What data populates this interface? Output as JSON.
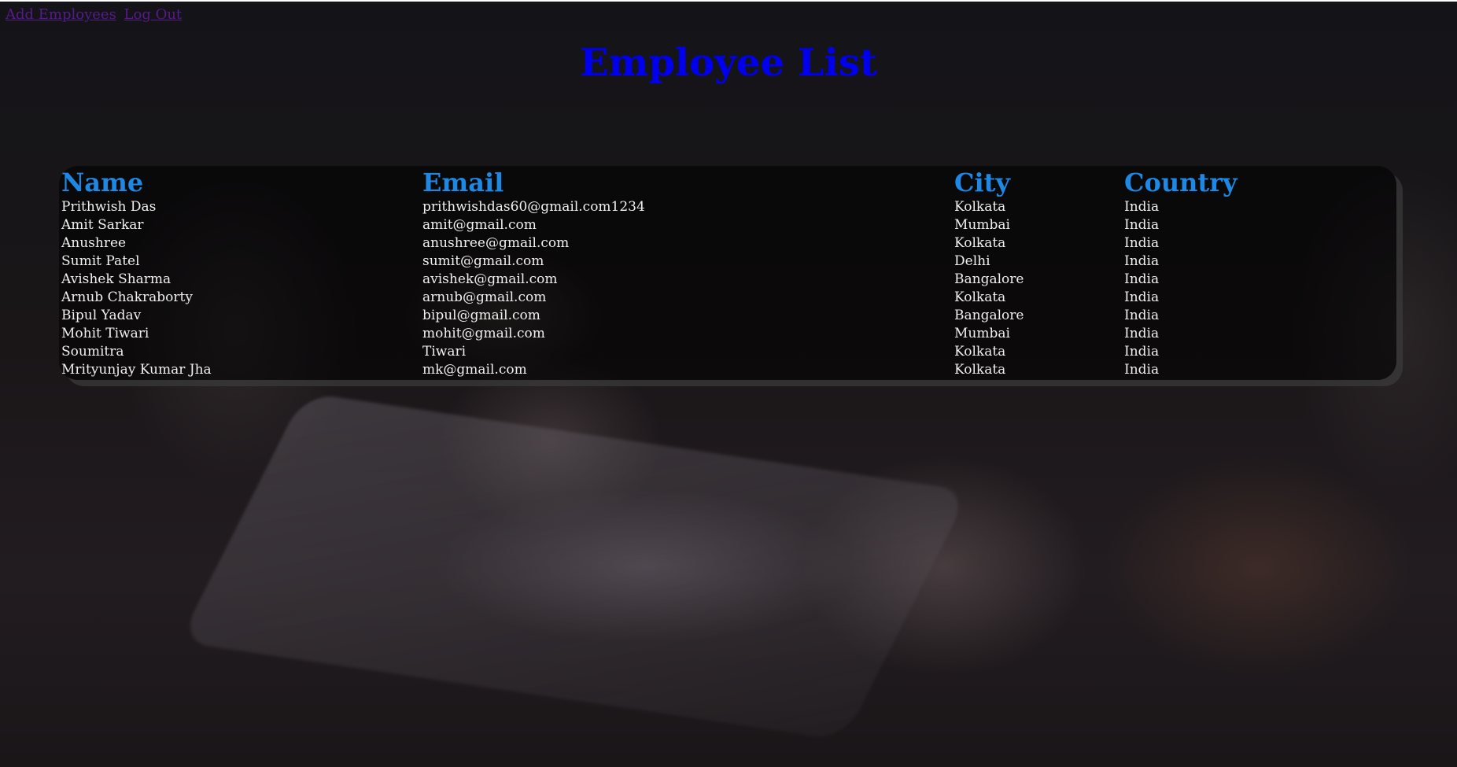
{
  "nav": {
    "add_employees": "Add Employees",
    "log_out": "Log Out"
  },
  "page": {
    "title": "Employee List"
  },
  "table": {
    "headers": [
      "Name",
      "Email",
      "City",
      "Country"
    ],
    "rows": [
      [
        "Prithwish Das",
        "prithwishdas60@gmail.com1234",
        "Kolkata",
        "India"
      ],
      [
        "Amit Sarkar",
        "amit@gmail.com",
        "Mumbai",
        "India"
      ],
      [
        "Anushree",
        "anushree@gmail.com",
        "Kolkata",
        "India"
      ],
      [
        "Sumit Patel",
        "sumit@gmail.com",
        "Delhi",
        "India"
      ],
      [
        "Avishek Sharma",
        "avishek@gmail.com",
        "Bangalore",
        "India"
      ],
      [
        "Arnub Chakraborty",
        "arnub@gmail.com",
        "Kolkata",
        "India"
      ],
      [
        "Bipul Yadav",
        "bipul@gmail.com",
        "Bangalore",
        "India"
      ],
      [
        "Mohit Tiwari",
        "mohit@gmail.com",
        "Mumbai",
        "India"
      ],
      [
        "Soumitra",
        "Tiwari",
        "Kolkata",
        "India"
      ],
      [
        "Mrityunjay Kumar Jha",
        "mk@gmail.com",
        "Kolkata",
        "India"
      ]
    ]
  },
  "colors": {
    "title": "#0000ee",
    "header_text": "#1e88e5",
    "cell_text": "#f0f0f0",
    "visited_link": "#551a8b"
  }
}
